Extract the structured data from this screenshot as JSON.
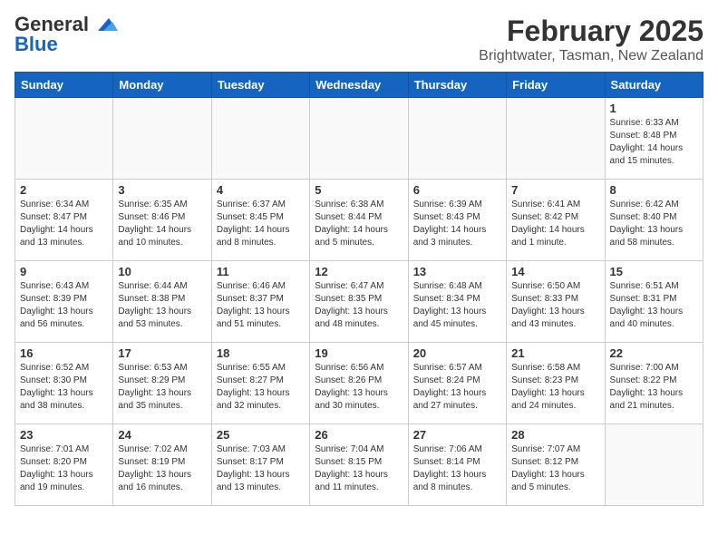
{
  "header": {
    "logo_general": "General",
    "logo_blue": "Blue",
    "title": "February 2025",
    "subtitle": "Brightwater, Tasman, New Zealand"
  },
  "weekdays": [
    "Sunday",
    "Monday",
    "Tuesday",
    "Wednesday",
    "Thursday",
    "Friday",
    "Saturday"
  ],
  "weeks": [
    [
      {
        "day": "",
        "info": ""
      },
      {
        "day": "",
        "info": ""
      },
      {
        "day": "",
        "info": ""
      },
      {
        "day": "",
        "info": ""
      },
      {
        "day": "",
        "info": ""
      },
      {
        "day": "",
        "info": ""
      },
      {
        "day": "1",
        "info": "Sunrise: 6:33 AM\nSunset: 8:48 PM\nDaylight: 14 hours\nand 15 minutes."
      }
    ],
    [
      {
        "day": "2",
        "info": "Sunrise: 6:34 AM\nSunset: 8:47 PM\nDaylight: 14 hours\nand 13 minutes."
      },
      {
        "day": "3",
        "info": "Sunrise: 6:35 AM\nSunset: 8:46 PM\nDaylight: 14 hours\nand 10 minutes."
      },
      {
        "day": "4",
        "info": "Sunrise: 6:37 AM\nSunset: 8:45 PM\nDaylight: 14 hours\nand 8 minutes."
      },
      {
        "day": "5",
        "info": "Sunrise: 6:38 AM\nSunset: 8:44 PM\nDaylight: 14 hours\nand 5 minutes."
      },
      {
        "day": "6",
        "info": "Sunrise: 6:39 AM\nSunset: 8:43 PM\nDaylight: 14 hours\nand 3 minutes."
      },
      {
        "day": "7",
        "info": "Sunrise: 6:41 AM\nSunset: 8:42 PM\nDaylight: 14 hours\nand 1 minute."
      },
      {
        "day": "8",
        "info": "Sunrise: 6:42 AM\nSunset: 8:40 PM\nDaylight: 13 hours\nand 58 minutes."
      }
    ],
    [
      {
        "day": "9",
        "info": "Sunrise: 6:43 AM\nSunset: 8:39 PM\nDaylight: 13 hours\nand 56 minutes."
      },
      {
        "day": "10",
        "info": "Sunrise: 6:44 AM\nSunset: 8:38 PM\nDaylight: 13 hours\nand 53 minutes."
      },
      {
        "day": "11",
        "info": "Sunrise: 6:46 AM\nSunset: 8:37 PM\nDaylight: 13 hours\nand 51 minutes."
      },
      {
        "day": "12",
        "info": "Sunrise: 6:47 AM\nSunset: 8:35 PM\nDaylight: 13 hours\nand 48 minutes."
      },
      {
        "day": "13",
        "info": "Sunrise: 6:48 AM\nSunset: 8:34 PM\nDaylight: 13 hours\nand 45 minutes."
      },
      {
        "day": "14",
        "info": "Sunrise: 6:50 AM\nSunset: 8:33 PM\nDaylight: 13 hours\nand 43 minutes."
      },
      {
        "day": "15",
        "info": "Sunrise: 6:51 AM\nSunset: 8:31 PM\nDaylight: 13 hours\nand 40 minutes."
      }
    ],
    [
      {
        "day": "16",
        "info": "Sunrise: 6:52 AM\nSunset: 8:30 PM\nDaylight: 13 hours\nand 38 minutes."
      },
      {
        "day": "17",
        "info": "Sunrise: 6:53 AM\nSunset: 8:29 PM\nDaylight: 13 hours\nand 35 minutes."
      },
      {
        "day": "18",
        "info": "Sunrise: 6:55 AM\nSunset: 8:27 PM\nDaylight: 13 hours\nand 32 minutes."
      },
      {
        "day": "19",
        "info": "Sunrise: 6:56 AM\nSunset: 8:26 PM\nDaylight: 13 hours\nand 30 minutes."
      },
      {
        "day": "20",
        "info": "Sunrise: 6:57 AM\nSunset: 8:24 PM\nDaylight: 13 hours\nand 27 minutes."
      },
      {
        "day": "21",
        "info": "Sunrise: 6:58 AM\nSunset: 8:23 PM\nDaylight: 13 hours\nand 24 minutes."
      },
      {
        "day": "22",
        "info": "Sunrise: 7:00 AM\nSunset: 8:22 PM\nDaylight: 13 hours\nand 21 minutes."
      }
    ],
    [
      {
        "day": "23",
        "info": "Sunrise: 7:01 AM\nSunset: 8:20 PM\nDaylight: 13 hours\nand 19 minutes."
      },
      {
        "day": "24",
        "info": "Sunrise: 7:02 AM\nSunset: 8:19 PM\nDaylight: 13 hours\nand 16 minutes."
      },
      {
        "day": "25",
        "info": "Sunrise: 7:03 AM\nSunset: 8:17 PM\nDaylight: 13 hours\nand 13 minutes."
      },
      {
        "day": "26",
        "info": "Sunrise: 7:04 AM\nSunset: 8:15 PM\nDaylight: 13 hours\nand 11 minutes."
      },
      {
        "day": "27",
        "info": "Sunrise: 7:06 AM\nSunset: 8:14 PM\nDaylight: 13 hours\nand 8 minutes."
      },
      {
        "day": "28",
        "info": "Sunrise: 7:07 AM\nSunset: 8:12 PM\nDaylight: 13 hours\nand 5 minutes."
      },
      {
        "day": "",
        "info": ""
      }
    ]
  ]
}
